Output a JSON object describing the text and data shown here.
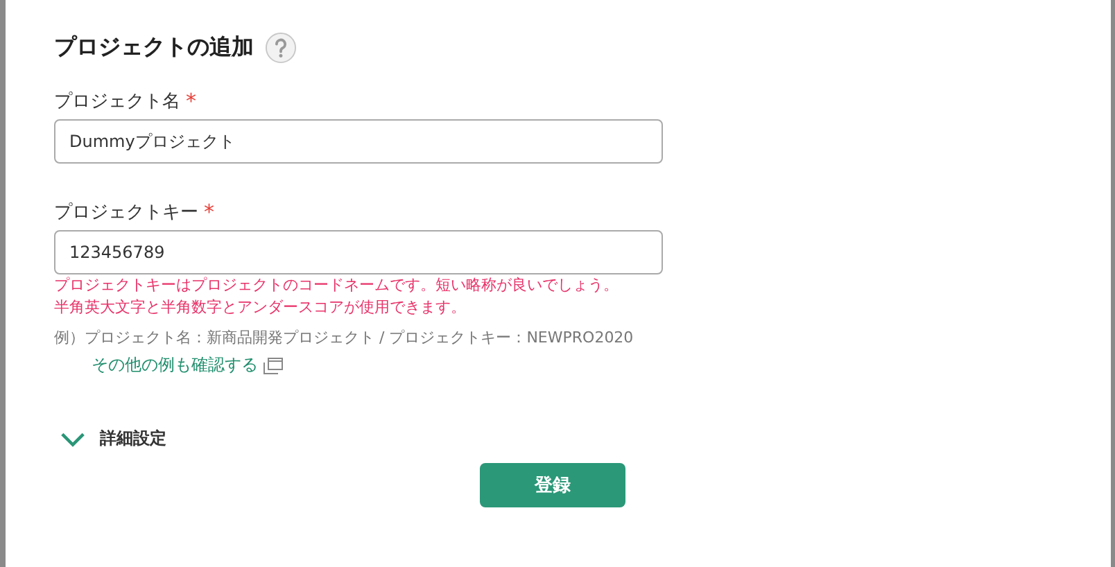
{
  "dialog": {
    "title": "プロジェクトの追加"
  },
  "fields": [
    {
      "label": "プロジェクト名",
      "required_mark": "*",
      "value": "Dummyプロジェクト"
    },
    {
      "label": "プロジェクトキー",
      "required_mark": "*",
      "value": "123456789"
    }
  ],
  "key_hint": {
    "errors": [
      "プロジェクトキーはプロジェクトのコードネームです。短い略称が良いでしょう。",
      "半角英大文字と半角数字とアンダースコアが使用できます。"
    ],
    "example": "例）プロジェクト名：新商品開発プロジェクト / プロジェクトキー：NEWPRO2020",
    "link": "その他の例も確認する"
  },
  "advanced": {
    "label": "詳細設定",
    "expanded": false
  },
  "submit_button": "登録"
}
